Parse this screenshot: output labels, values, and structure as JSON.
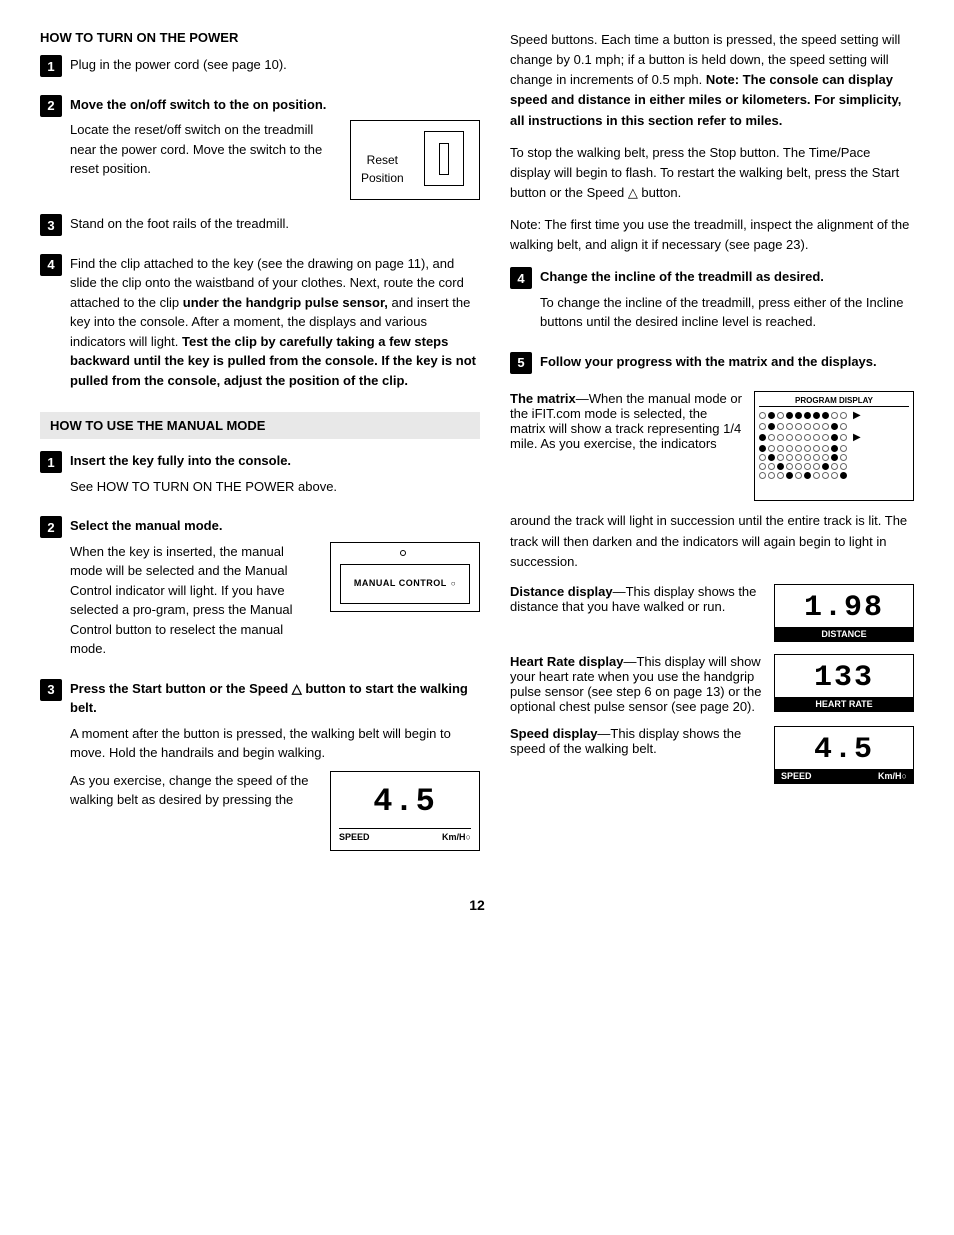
{
  "left": {
    "section1_title": "HOW TO TURN ON THE POWER",
    "step1_text": "Plug in the power cord (see page 10).",
    "step2_heading": "Move the on/off switch to the on position.",
    "step2_body": "Locate the reset/off switch on the treadmill near the power cord. Move the switch to the reset position.",
    "reset_position_label": "Reset\nPosition",
    "step3_text": "Stand on the foot rails of the treadmill.",
    "step4_text": "Find the clip attached to the key (see the drawing on page 11), and slide the clip onto the waistband of your clothes. Next, route the cord attached to the clip ",
    "step4_bold": "under the handgrip pulse sensor,",
    "step4_text2": " and insert the key into the console. After a moment, the displays and various indicators will light. ",
    "step4_bold2": "Test the clip by carefully taking a few steps backward until the key is pulled from the console. If the key is not pulled from the console, adjust the position of the clip.",
    "manual_section_title": "HOW TO USE THE MANUAL MODE",
    "manual_step1_heading": "Insert the key fully into the console.",
    "manual_step1_body": "See HOW TO TURN ON THE POWER above.",
    "manual_step2_heading": "Select the manual mode.",
    "manual_step2_body1": "When the key is inserted, the manual mode will be selected and the Manual Control indicator will light. If you have selected a pro-gram, press the Manual Control button to reselect the manual mode.",
    "manual_control_label": "MANUAL CONTROL",
    "manual_step3_heading": "Press the Start button or the Speed △ button to start the walking belt.",
    "manual_step3_body1": "A moment after the button is pressed, the walking belt will begin to move. Hold the handrails and begin walking.",
    "manual_step3_body2": "As you exercise, change the speed of the walking belt as desired by pressing the",
    "speed_num": "4.5",
    "speed_label": "SPEED",
    "speed_unit": "Km/H○"
  },
  "right": {
    "para1": "Speed buttons. Each time a button is pressed, the speed setting will change by 0.1 mph; if a button is held down, the speed setting will change in increments of 0.5 mph. ",
    "para1_bold": "Note: The console can display speed and distance in either miles or kilometers. For simplicity, all instructions in this section refer to miles.",
    "para2": "To stop the walking belt, press the Stop button. The Time/Pace display will begin to flash. To restart the walking belt, press the Start button or the Speed △ button.",
    "para3": "Note: The first time you use the treadmill, inspect the alignment of the walking belt, and align it if necessary (see page 23).",
    "step4_heading": "Change the incline of the treadmill as desired.",
    "step4_body": "To change the incline of the treadmill, press either of the Incline buttons until the desired incline level is reached.",
    "step5_heading": "Follow your progress with the matrix and the displays.",
    "matrix_heading": "The matrix",
    "matrix_body": "—When the manual mode or the iFIT.com mode is selected, the matrix will show a track representing 1/4 mile. As you exercise, the indicators",
    "matrix_body2": "around the track will light in succession until the entire track is lit. The track will then darken and the indicators will again begin to light in succession.",
    "prog_display_title": "PROGRAM DISPLAY",
    "distance_heading": "Distance display",
    "distance_body": "—This display shows the distance that you have walked or run.",
    "distance_num": "1.98",
    "distance_label": "DISTANCE",
    "hr_heading": "Heart Rate display",
    "hr_body": "—This display will show your heart rate when you use the handgrip pulse sensor (see step 6 on page 13) or the optional chest pulse sensor (see page 20).",
    "hr_num": "133",
    "hr_label": "HEART RATE",
    "speed_heading": "Speed display",
    "speed_body": "—This display shows the speed of the walking belt.",
    "speed_num": "4.5",
    "speed_label": "SPEED",
    "speed_unit": "Km/H○"
  },
  "page_number": "12"
}
